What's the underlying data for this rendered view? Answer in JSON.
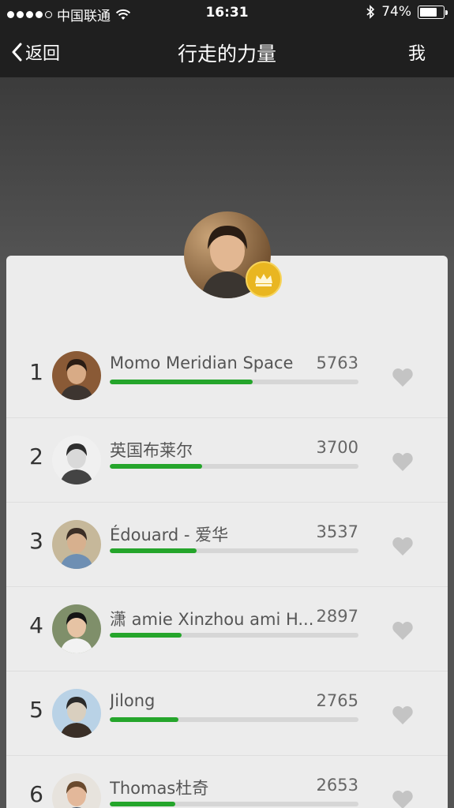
{
  "status_bar": {
    "carrier": "中国联通",
    "time": "16:31",
    "battery": "74%",
    "battery_level": 0.74,
    "signal_dots_filled": 4,
    "icons": [
      "wifi-icon",
      "bluetooth-icon",
      "battery-icon"
    ]
  },
  "nav": {
    "back_label": "返回",
    "title": "行走的力量",
    "right_label": "我"
  },
  "champion": {
    "badge_icon": "crown-icon",
    "badge_color": "#e9b621"
  },
  "colors": {
    "progress": "#25a52b",
    "track": "#d6d6d6",
    "like": "#c4c4c4"
  },
  "ranking": [
    {
      "rank": "1",
      "name": "Momo Meridian Space",
      "score": "5763",
      "progress": 0.575
    },
    {
      "rank": "2",
      "name": "英国布莱尔",
      "score": "3700",
      "progress": 0.37
    },
    {
      "rank": "3",
      "name": "Édouard - 爱华",
      "score": "3537",
      "progress": 0.35
    },
    {
      "rank": "4",
      "name": "潇 amie Xinzhou ami H...",
      "score": "2897",
      "progress": 0.29
    },
    {
      "rank": "5",
      "name": "Jilong",
      "score": "2765",
      "progress": 0.275
    },
    {
      "rank": "6",
      "name": "Thomas杜奇",
      "score": "2653",
      "progress": 0.265
    }
  ]
}
